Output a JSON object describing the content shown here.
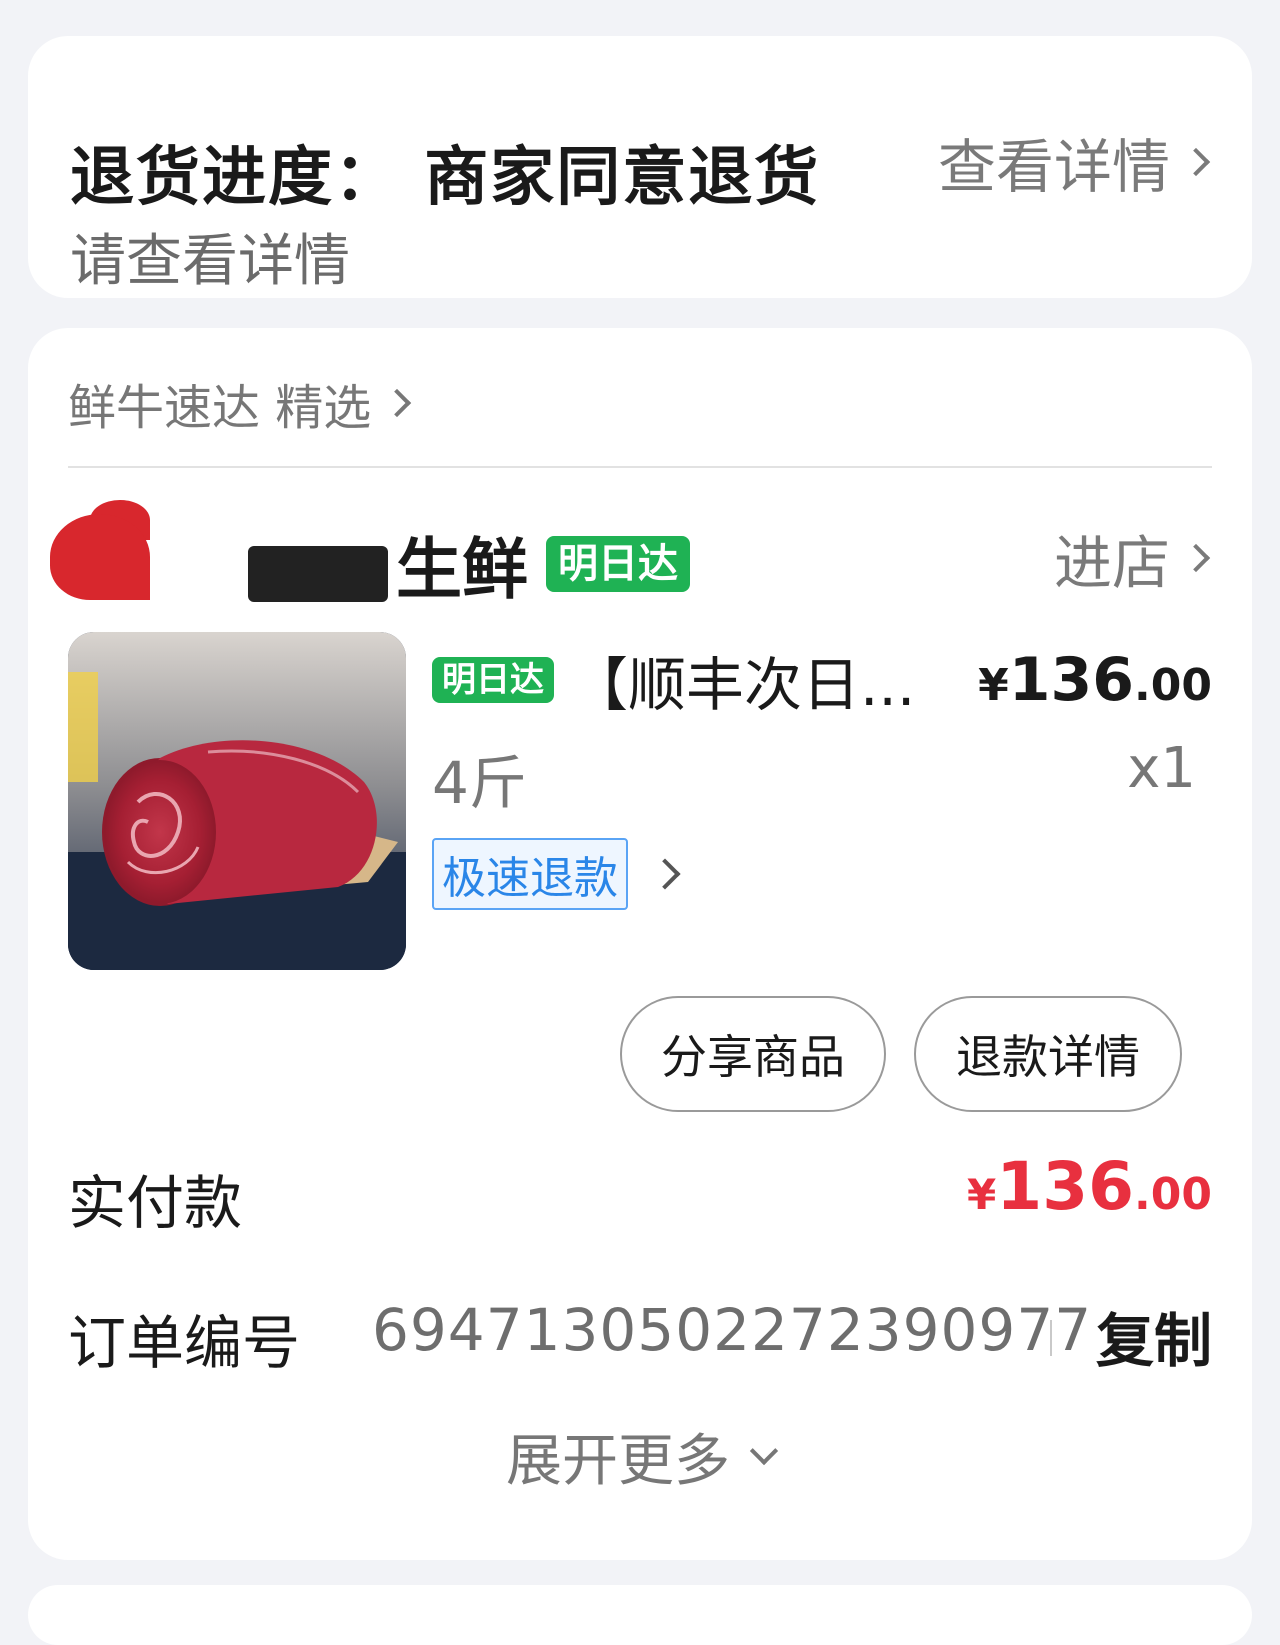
{
  "progress": {
    "title": "退货进度： 商家同意退货",
    "subtitle": "请查看详情",
    "detail_link": "查看详情"
  },
  "order": {
    "source": "鲜牛速达 精选",
    "shop": {
      "name": "生鲜",
      "badge": "明日达",
      "enter_label": "进店"
    },
    "product": {
      "badge": "明日达",
      "title": "【顺丰次日...",
      "price_currency": "¥",
      "price_integer": "136",
      "price_decimal": ".00",
      "spec": "4斤",
      "quantity": "x1",
      "refund_tag": "极速退款"
    },
    "actions": {
      "share": "分享商品",
      "refund_detail": "退款详情"
    },
    "paid": {
      "label": "实付款",
      "currency": "¥",
      "integer": "136",
      "decimal": ".00",
      "color": "#e8303f"
    },
    "order_number": {
      "label": "订单编号",
      "value": "6947130502272390977",
      "copy_label": "复制"
    },
    "expand_label": "展开更多"
  },
  "colors": {
    "badge_green": "#1fb254",
    "refund_blue": "#2a86e8",
    "background": "#f2f3f7"
  }
}
